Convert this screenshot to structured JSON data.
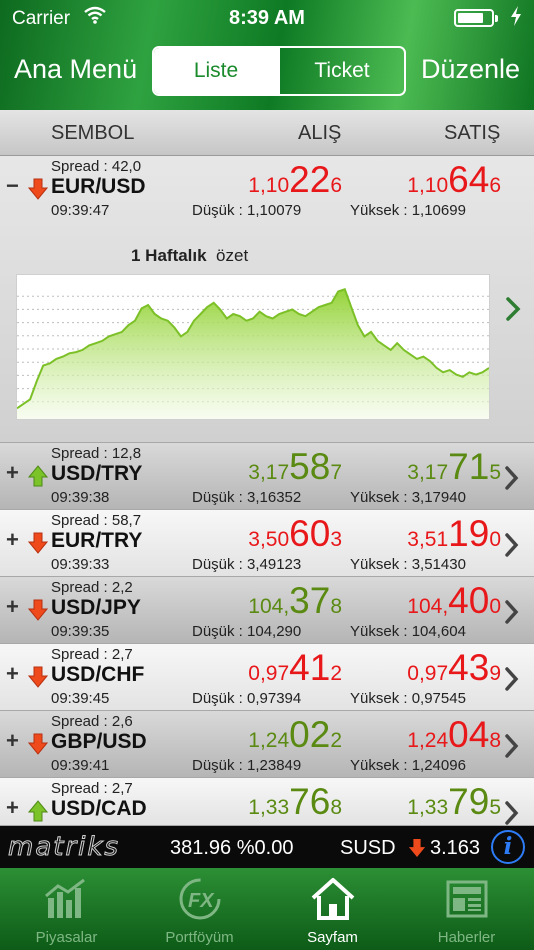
{
  "status_bar": {
    "carrier": "Carrier",
    "time": "8:39 AM"
  },
  "nav": {
    "left": "Ana Menü",
    "right": "Düzenle",
    "segments": [
      "Liste",
      "Ticket"
    ],
    "active_segment": "Liste"
  },
  "columns": {
    "symbol": "SEMBOL",
    "bid": "ALIŞ",
    "ask": "SATIŞ"
  },
  "expanded_row": {
    "toggle": "−",
    "direction": "down",
    "spread": "Spread : 42,0",
    "symbol": "EUR/USD",
    "time": "09:39:47",
    "bid": {
      "small": "1,10",
      "big": "22",
      "end": "6",
      "color": "#e8171a"
    },
    "ask": {
      "small": "1,10",
      "big": "64",
      "end": "6",
      "color": "#e8171a"
    },
    "low": "Düşük :  1,10079",
    "high": "Yüksek : 1,10699",
    "summary_bold": "1 Haftalık",
    "summary_text": "özet",
    "chart_data": {
      "type": "area",
      "title": "",
      "xlabel": "",
      "ylabel": "",
      "grid": true,
      "color": "#8fd12e",
      "values": [
        6,
        10,
        14,
        30,
        44,
        46,
        50,
        52,
        55,
        56,
        58,
        62,
        64,
        66,
        70,
        72,
        74,
        80,
        84,
        95,
        98,
        90,
        86,
        84,
        78,
        70,
        74,
        84,
        90,
        96,
        100,
        94,
        86,
        90,
        88,
        84,
        86,
        92,
        88,
        86,
        90,
        92,
        94,
        90,
        88,
        92,
        96,
        98,
        100,
        110,
        112,
        96,
        80,
        70,
        74,
        66,
        62,
        58,
        64,
        58,
        54,
        50,
        52,
        48,
        42,
        38,
        40,
        36,
        34,
        38,
        36,
        38,
        42
      ]
    }
  },
  "rows": [
    {
      "direction": "up",
      "spread": "Spread : 12,8",
      "symbol": "USD/TRY",
      "time": "09:39:38",
      "bid": {
        "small": "3,17",
        "big": "58",
        "end": "7",
        "color": "#5a8a12"
      },
      "ask": {
        "small": "3,17",
        "big": "71",
        "end": "5",
        "color": "#5a8a12"
      },
      "low": "Düşük :  3,16352",
      "high": "Yüksek : 3,17940",
      "shade": "dark"
    },
    {
      "direction": "down",
      "spread": "Spread : 58,7",
      "symbol": "EUR/TRY",
      "time": "09:39:33",
      "bid": {
        "small": "3,50",
        "big": "60",
        "end": "3",
        "color": "#e8171a"
      },
      "ask": {
        "small": "3,51",
        "big": "19",
        "end": "0",
        "color": "#e8171a"
      },
      "low": "Düşük :  3,49123",
      "high": "Yüksek : 3,51430",
      "shade": "light"
    },
    {
      "direction": "down",
      "spread": "Spread : 2,2",
      "symbol": "USD/JPY",
      "time": "09:39:35",
      "bid": {
        "small": "104,",
        "big": "37",
        "end": "8",
        "color": "#5a8a12"
      },
      "ask": {
        "small": "104,",
        "big": "40",
        "end": "0",
        "color": "#e8171a"
      },
      "low": "Düşük :  104,290",
      "high": "Yüksek : 104,604",
      "shade": "dark"
    },
    {
      "direction": "down",
      "spread": "Spread : 2,7",
      "symbol": "USD/CHF",
      "time": "09:39:45",
      "bid": {
        "small": "0,97",
        "big": "41",
        "end": "2",
        "color": "#e8171a"
      },
      "ask": {
        "small": "0,97",
        "big": "43",
        "end": "9",
        "color": "#e8171a"
      },
      "low": "Düşük :  0,97394",
      "high": "Yüksek : 0,97545",
      "shade": "light"
    },
    {
      "direction": "down",
      "spread": "Spread : 2,6",
      "symbol": "GBP/USD",
      "time": "09:39:41",
      "bid": {
        "small": "1,24",
        "big": "02",
        "end": "2",
        "color": "#5a8a12"
      },
      "ask": {
        "small": "1,24",
        "big": "04",
        "end": "8",
        "color": "#e8171a"
      },
      "low": "Düşük :  1,23849",
      "high": "Yüksek : 1,24096",
      "shade": "dark"
    },
    {
      "direction": "up",
      "spread": "Spread : 2,7",
      "symbol": "USD/CAD",
      "time": "",
      "bid": {
        "small": "1,33",
        "big": "76",
        "end": "8",
        "color": "#5a8a12"
      },
      "ask": {
        "small": "1,33",
        "big": "79",
        "end": "5",
        "color": "#5a8a12"
      },
      "low": "",
      "high": "",
      "shade": "light"
    }
  ],
  "row_toggle": "+",
  "ticker": {
    "logo": "matriks",
    "text1": "381.96 %0.00",
    "symbol": "SUSD",
    "direction": "down",
    "value": "3.163",
    "info": "i"
  },
  "tabs": [
    {
      "label": "Piyasalar",
      "icon": "market-chart-icon",
      "active": false
    },
    {
      "label": "Portföyüm",
      "icon": "fx-portfolio-icon",
      "active": false
    },
    {
      "label": "Sayfam",
      "icon": "home-icon",
      "active": true
    },
    {
      "label": "Haberler",
      "icon": "news-icon",
      "active": false
    }
  ]
}
